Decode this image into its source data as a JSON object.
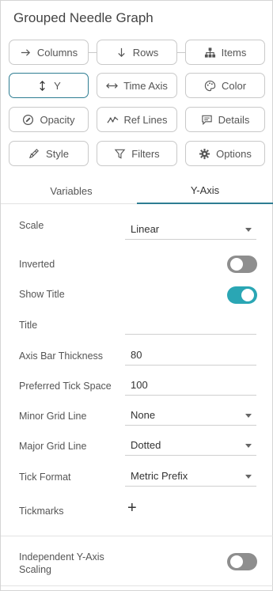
{
  "panel": {
    "title": "Grouped Needle Graph"
  },
  "buttons": {
    "columns": "Columns",
    "rows": "Rows",
    "items": "Items",
    "y": "Y",
    "time_axis": "Time Axis",
    "color": "Color",
    "opacity": "Opacity",
    "ref_lines": "Ref Lines",
    "details": "Details",
    "style": "Style",
    "filters": "Filters",
    "options": "Options"
  },
  "tabs": {
    "variables": "Variables",
    "y_axis": "Y-Axis",
    "active": "Y-Axis"
  },
  "settings": {
    "scale": {
      "label": "Scale",
      "value": "Linear"
    },
    "inverted": {
      "label": "Inverted",
      "on": false
    },
    "show_title": {
      "label": "Show Title",
      "on": true
    },
    "title": {
      "label": "Title",
      "value": ""
    },
    "axis_bar_thickness": {
      "label": "Axis Bar Thickness",
      "value": "80"
    },
    "preferred_tick_space": {
      "label": "Preferred Tick Space",
      "value": "100"
    },
    "minor_grid_line": {
      "label": "Minor Grid Line",
      "value": "None"
    },
    "major_grid_line": {
      "label": "Major Grid Line",
      "value": "Dotted"
    },
    "tick_format": {
      "label": "Tick Format",
      "value": "Metric Prefix"
    },
    "tickmarks": {
      "label": "Tickmarks",
      "add_symbol": "+"
    },
    "independent_scaling": {
      "label_line1": "Independent Y-Axis",
      "label_line2": "Scaling",
      "on": false
    }
  },
  "colors": {
    "accent": "#2e7d92",
    "toggle_on": "#2aa6b4",
    "toggle_off": "#8e8e8e"
  }
}
